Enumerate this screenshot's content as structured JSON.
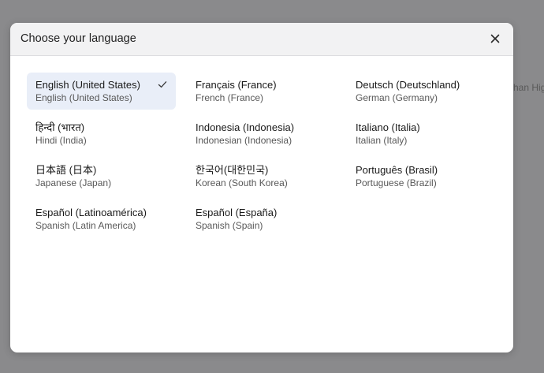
{
  "background": {
    "peek_text": "han Hig"
  },
  "modal": {
    "title": "Choose your language",
    "close_icon": "close-icon"
  },
  "languages": [
    {
      "name": "English (United States)",
      "sub": "English (United States)",
      "selected": true
    },
    {
      "name": "Français (France)",
      "sub": "French (France)",
      "selected": false
    },
    {
      "name": "Deutsch (Deutschland)",
      "sub": "German (Germany)",
      "selected": false
    },
    {
      "name": "हिन्दी (भारत)",
      "sub": "Hindi (India)",
      "selected": false
    },
    {
      "name": "Indonesia (Indonesia)",
      "sub": "Indonesian (Indonesia)",
      "selected": false
    },
    {
      "name": "Italiano (Italia)",
      "sub": "Italian (Italy)",
      "selected": false
    },
    {
      "name": "日本語 (日本)",
      "sub": "Japanese (Japan)",
      "selected": false
    },
    {
      "name": "한국어(대한민국)",
      "sub": "Korean (South Korea)",
      "selected": false
    },
    {
      "name": "Português (Brasil)",
      "sub": "Portuguese (Brazil)",
      "selected": false
    },
    {
      "name": "Español (Latinoamérica)",
      "sub": "Spanish (Latin America)",
      "selected": false
    },
    {
      "name": "Español (España)",
      "sub": "Spanish (Spain)",
      "selected": false
    }
  ],
  "colors": {
    "selected_bg": "#e9eef8",
    "backdrop": "#8a8a8c",
    "header_bg": "#f2f2f3"
  }
}
